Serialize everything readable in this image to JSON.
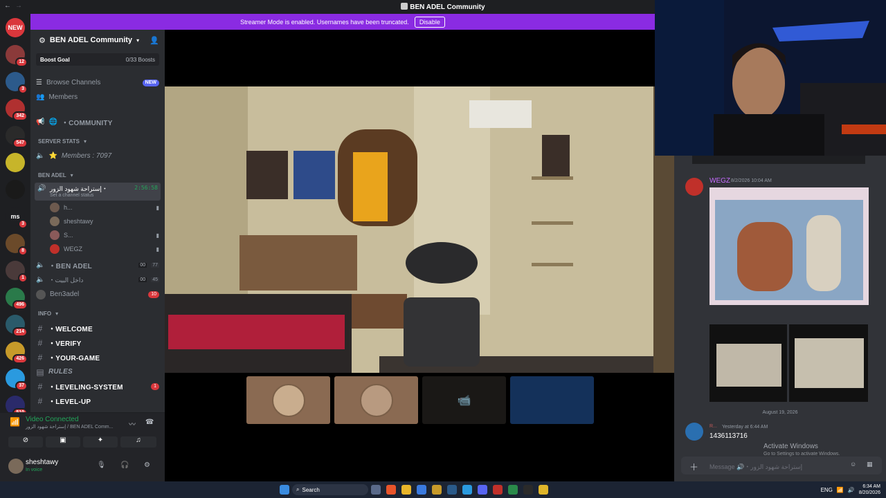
{
  "titlebar": {
    "title": "BEN ADEL Community"
  },
  "banner": {
    "text": "Streamer Mode is enabled. Usernames have been truncated.",
    "button": "Disable"
  },
  "servers": [
    {
      "label": "NEW",
      "badge": "",
      "color": "#da373c"
    },
    {
      "label": "",
      "badge": "12",
      "color": "#8b3a3a"
    },
    {
      "label": "",
      "badge": "3",
      "color": "#2c5a8b"
    },
    {
      "label": "",
      "badge": "342",
      "color": "#b03030"
    },
    {
      "label": "",
      "badge": "547",
      "color": "#2a2a2a"
    },
    {
      "label": "",
      "badge": "",
      "color": "#c7b52a"
    },
    {
      "label": "",
      "badge": "",
      "color": "#1a1a1a"
    },
    {
      "label": "ms",
      "badge": "3",
      "color": "#1e1f22"
    },
    {
      "label": "",
      "badge": "8",
      "color": "#6b4a2a"
    },
    {
      "label": "",
      "badge": "1",
      "color": "#4a3a3a"
    },
    {
      "label": "",
      "badge": "496",
      "color": "#2a7a4a"
    },
    {
      "label": "",
      "badge": "214",
      "color": "#2a5a6a"
    },
    {
      "label": "",
      "badge": "426",
      "color": "#c79a2a"
    },
    {
      "label": "",
      "badge": "37",
      "color": "#2a9adf"
    },
    {
      "label": "",
      "badge": "510",
      "color": "#2a2a6a"
    },
    {
      "label": "SS",
      "badge": "",
      "color": "#1e1f22"
    },
    {
      "label": "",
      "badge": "45",
      "color": "#c7a22a"
    },
    {
      "label": "FX",
      "badge": "",
      "color": "#3a3a3a"
    },
    {
      "label": "+",
      "badge": "",
      "color": "#313338"
    }
  ],
  "sidebar": {
    "server_name": "BEN ADEL Community",
    "boost_goal": "Boost Goal",
    "boosts": "0/33 Boosts",
    "browse_channels": "Browse Channels",
    "browse_new": "NEW",
    "members": "Members",
    "community": "・COMMUNITY",
    "server_stats": "SERVER STATS",
    "members_count": "Members : 7097",
    "ben_adel_cat": "BEN ADEL",
    "active_voice": {
      "name": "إستراحة شهود الزور・",
      "time": "2:56:58",
      "status": "Set a channel status"
    },
    "voice_users": [
      "h...",
      "sheshtawy",
      "S...",
      "WEGZ"
    ],
    "voice2": {
      "name": "・BEN ADEL",
      "left": "00",
      "right": "77"
    },
    "voice3": {
      "name": "・داخل البيت",
      "left": "00",
      "right": "45"
    },
    "ben3adel": {
      "name": "Ben3adel",
      "badge": "10"
    },
    "info_cat": "INFO",
    "channels": [
      {
        "name": "・WELCOME",
        "badge": ""
      },
      {
        "name": "・VERIFY",
        "badge": ""
      },
      {
        "name": "・YOUR-GAME",
        "badge": ""
      },
      {
        "name": "RULES",
        "badge": ""
      },
      {
        "name": "・LEVELING-SYSTEM",
        "badge": "1"
      },
      {
        "name": "・LEVEL-UP",
        "badge": ""
      }
    ]
  },
  "voice_panel": {
    "status": "Video Connected",
    "channel": "إستراحة شهود الزور / BEN ADEL Comm...",
    "user": "sheshtawy",
    "user_status": "In voice"
  },
  "chat": {
    "author": "WEGZ",
    "timestamp": "8/2/2026 10:04 AM",
    "divider": "August 19, 2026",
    "msg2_author": "R...",
    "msg2_time": "Yesterday at 6:44 AM",
    "msg2_text": "1436113716",
    "input_placeholder": "Message 🔊・إستراحة شهود الزور",
    "activate_title": "Activate Windows",
    "activate_sub": "Go to Settings to activate Windows."
  },
  "taskbar": {
    "search": "Search",
    "lang": "ENG",
    "time": "6:34 AM",
    "date": "8/20/2026"
  }
}
